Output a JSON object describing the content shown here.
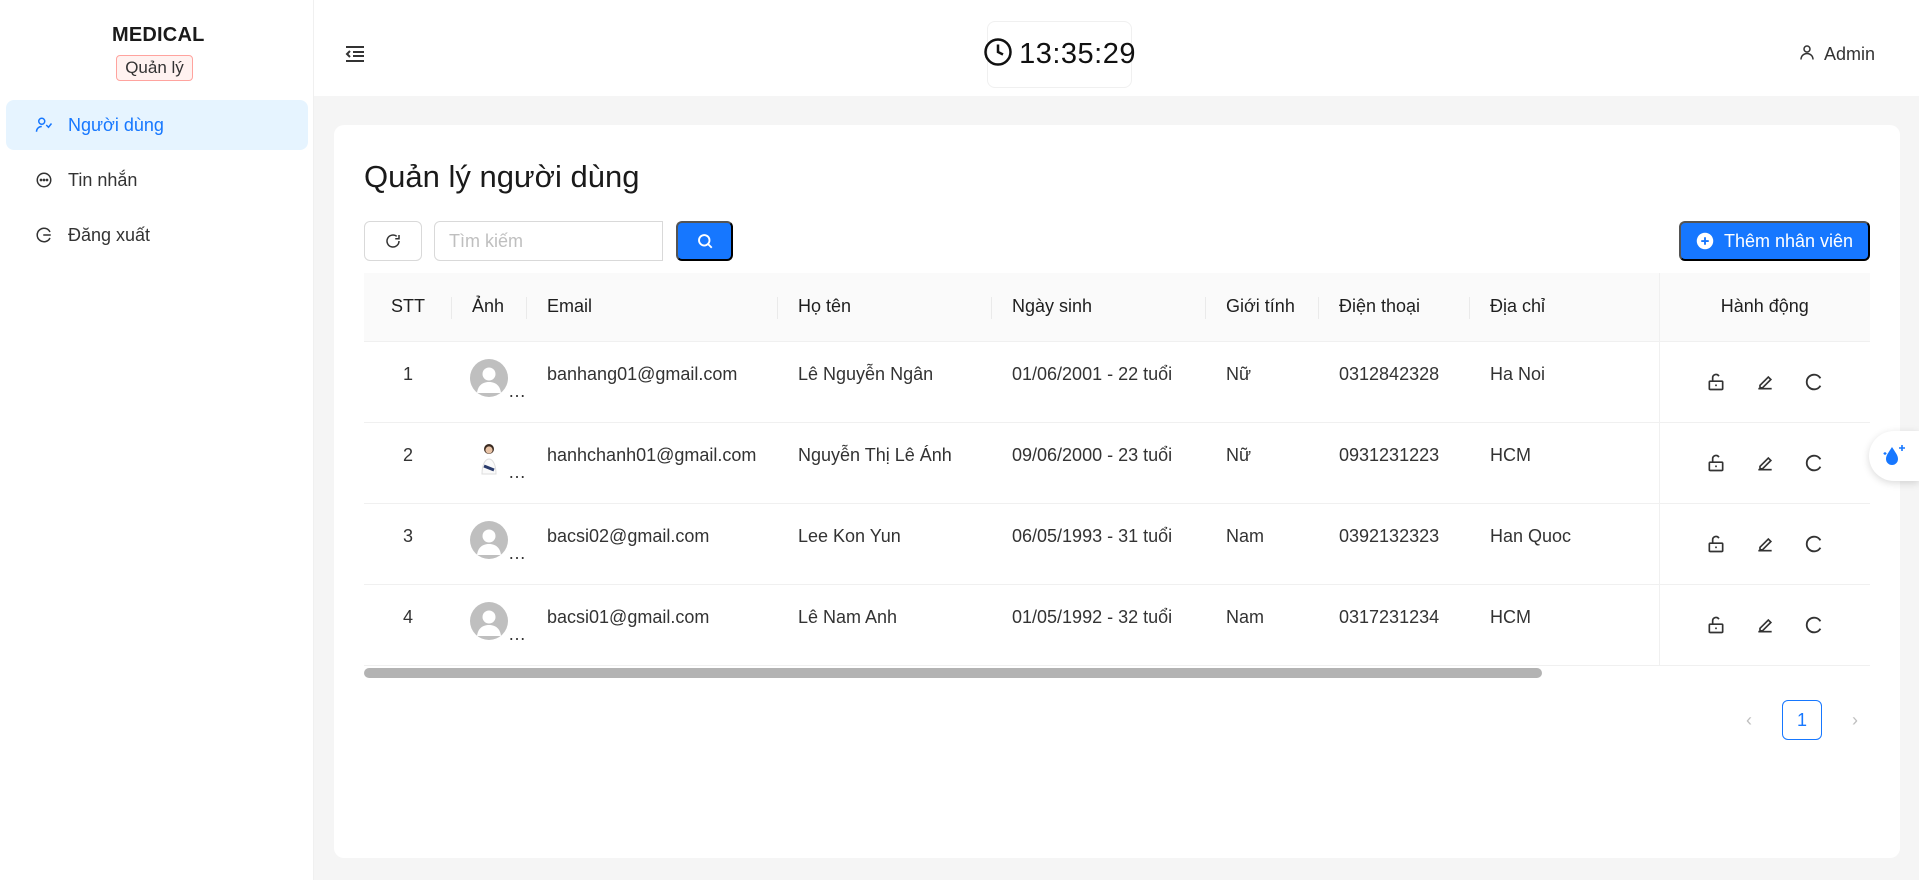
{
  "sidebar": {
    "brand": "MEDICAL",
    "role_tag": "Quản lý",
    "items": [
      {
        "label": "Người dùng",
        "icon": "users-icon",
        "active": true
      },
      {
        "label": "Tin nhắn",
        "icon": "message-icon",
        "active": false
      },
      {
        "label": "Đăng xuất",
        "icon": "logout-icon",
        "active": false
      }
    ]
  },
  "header": {
    "clock": "13:35:29",
    "user": "Admin"
  },
  "main": {
    "title": "Quản lý người dùng",
    "search_placeholder": "Tìm kiếm",
    "add_label": "Thêm nhân viên",
    "accent": "#1677ff"
  },
  "table": {
    "columns": [
      "STT",
      "Ảnh",
      "Email",
      "Họ tên",
      "Ngày sinh",
      "Giới tính",
      "Điện thoại",
      "Địa chỉ",
      "Hành động"
    ],
    "rows": [
      {
        "stt": "1",
        "avatar": "default",
        "email": "banhang01@gmail.com",
        "name": "Lê Nguyễn Ngân",
        "dob": "01/06/2001 - 22 tuổi",
        "gender": "Nữ",
        "phone": "0312842328",
        "address": "Ha Noi"
      },
      {
        "stt": "2",
        "avatar": "photo",
        "email": "hanhchanh01@gmail.com",
        "name": "Nguyễn Thị Lê Ánh",
        "dob": "09/06/2000 - 23 tuổi",
        "gender": "Nữ",
        "phone": "0931231223",
        "address": "HCM"
      },
      {
        "stt": "3",
        "avatar": "default",
        "email": "bacsi02@gmail.com",
        "name": "Lee Kon Yun",
        "dob": "06/05/1993 - 31 tuổi",
        "gender": "Nam",
        "phone": "0392132323",
        "address": "Han Quoc"
      },
      {
        "stt": "4",
        "avatar": "default",
        "email": "bacsi01@gmail.com",
        "name": "Lê Nam Anh",
        "dob": "01/05/1992 - 32 tuổi",
        "gender": "Nam",
        "phone": "0317231234",
        "address": "HCM"
      }
    ]
  },
  "pagination": {
    "current": "1"
  }
}
